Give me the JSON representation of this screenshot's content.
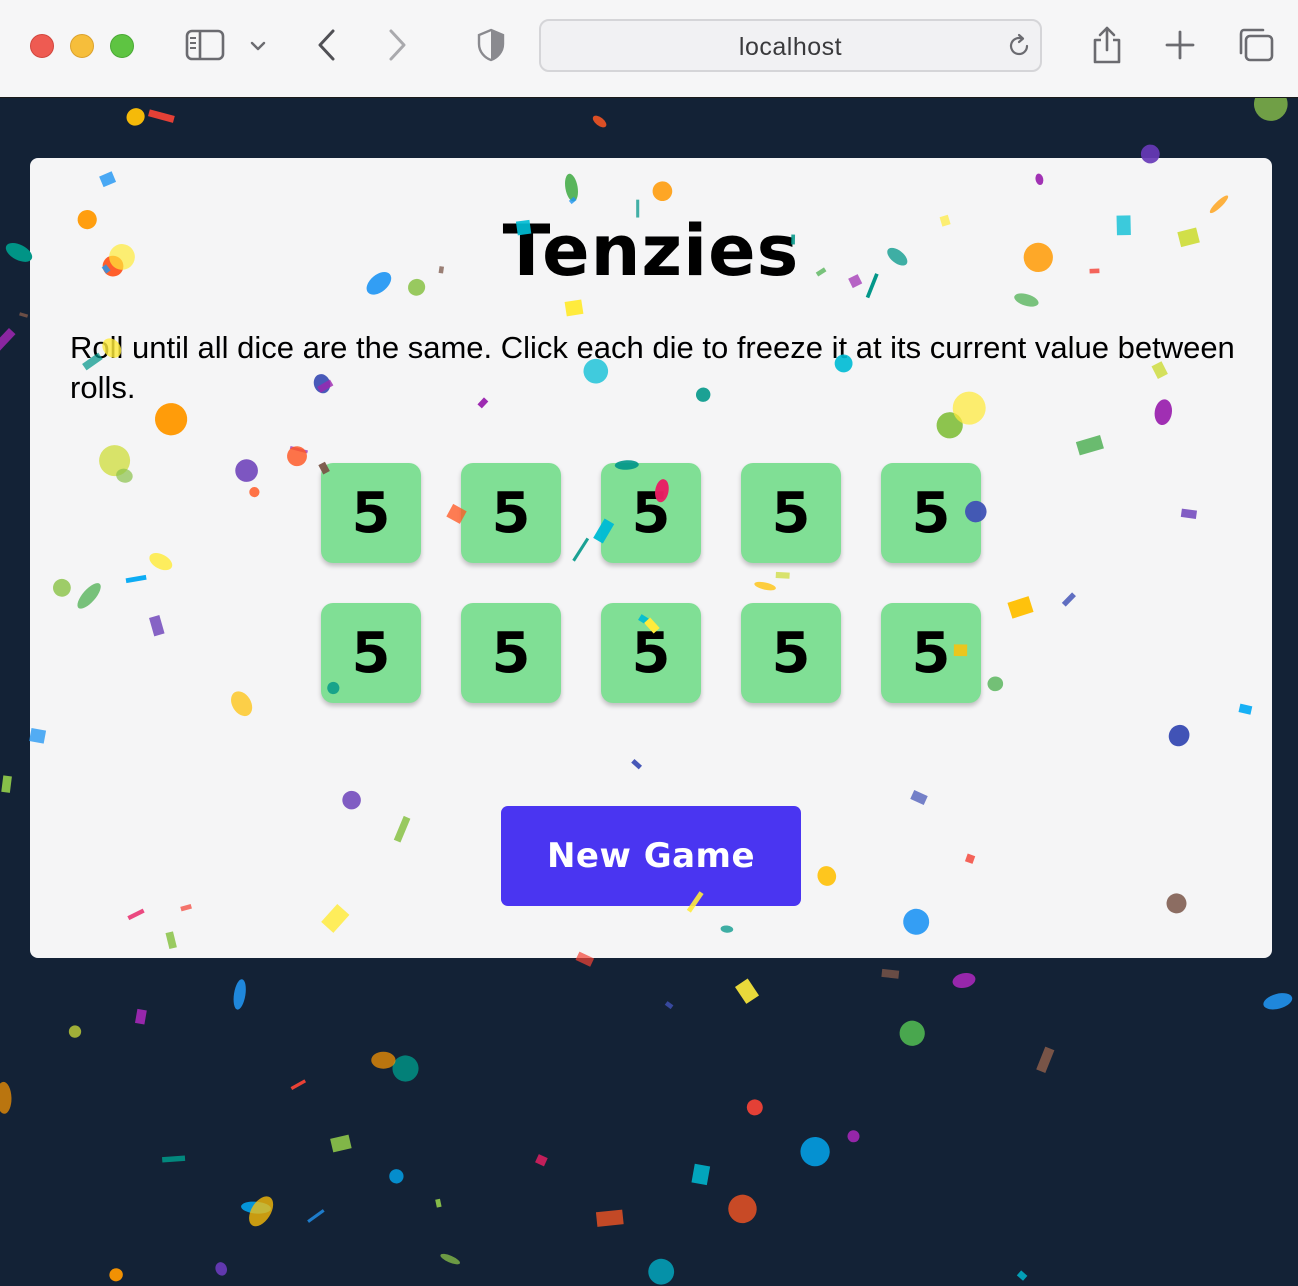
{
  "browser": {
    "url": "localhost",
    "icons": [
      "close-window-icon",
      "minimize-window-icon",
      "zoom-window-icon",
      "sidebar-icon",
      "chevron-down-icon",
      "back-arrow-icon",
      "forward-arrow-icon",
      "shield-icon",
      "reload-icon",
      "share-icon",
      "plus-icon",
      "tabs-overview-icon"
    ]
  },
  "game": {
    "title": "Tenzies",
    "instructions": "Roll until all dice are the same. Click each die to freeze it at its current value between rolls.",
    "dice": [
      {
        "value": "5"
      },
      {
        "value": "5"
      },
      {
        "value": "5"
      },
      {
        "value": "5"
      },
      {
        "value": "5"
      },
      {
        "value": "5"
      },
      {
        "value": "5"
      },
      {
        "value": "5"
      },
      {
        "value": "5"
      },
      {
        "value": "5"
      }
    ],
    "new_game_label": "New Game"
  },
  "colors": {
    "page_background": "#132236",
    "card_background": "#f5f5f6",
    "die_held": "#80df95",
    "button": "#4a35f1",
    "confetti": [
      "#f44336",
      "#e91e63",
      "#9c27b0",
      "#673ab7",
      "#3f51b5",
      "#2196f3",
      "#03a9f4",
      "#00bcd4",
      "#009688",
      "#4caf50",
      "#8bc34a",
      "#cddc39",
      "#ffeb3b",
      "#ffc107",
      "#ff9800",
      "#ff5722",
      "#795548"
    ]
  }
}
